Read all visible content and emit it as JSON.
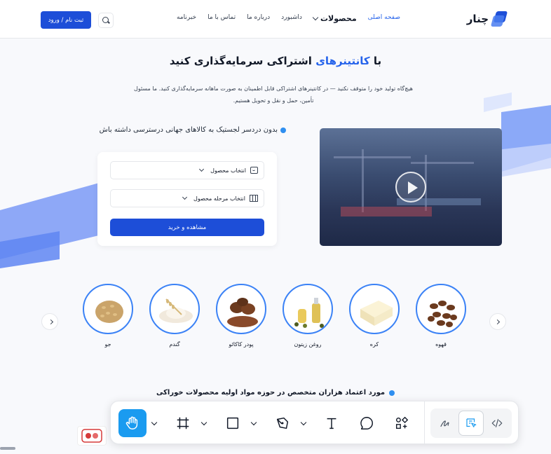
{
  "header": {
    "brand": "چنار",
    "nav": [
      {
        "label": "صفحه اصلی",
        "active": true
      },
      {
        "label": "محصولات",
        "dropdown": true
      },
      {
        "label": "داشبورد"
      },
      {
        "label": "درباره ما"
      },
      {
        "label": "تماس با ما"
      },
      {
        "label": "خبرنامه"
      }
    ],
    "signup_label": "ثبت نام / ورود"
  },
  "hero": {
    "title_pre": "با ",
    "title_highlight": "کانتینرهای",
    "title_post": " اشتراکی سرمایه‌گذاری کنید",
    "description": "هیچ‌گاه تولید خود را متوقف نکنید — در کانتینرهای اشتراکی قابل اطمینان به صورت ماهانه سرمایه‌گذاری کنید. ما مسئول تأمین، حمل و نقل و تحویل هستیم.",
    "bullet": "بدون دردسر لجستیک به کالاهای جهانی درسترسی داشته باش"
  },
  "form": {
    "product_select": "انتخاب محصول",
    "stage_select": "انتخاب مرحله محصول",
    "buy_button": "مشاهده و خرید"
  },
  "products": [
    {
      "label": "قهوه"
    },
    {
      "label": "کره"
    },
    {
      "label": "روغن زیتون"
    },
    {
      "label": "پودر کاکائو"
    },
    {
      "label": "گندم"
    },
    {
      "label": "جو"
    }
  ],
  "trust_line": "مورد اعتماد هزاران متخصص در حوزه مواد اولیه محصولات خوراکی",
  "toolbar": {
    "tools": [
      "hand-icon",
      "frame-icon",
      "rectangle-icon",
      "pen-icon",
      "text-icon",
      "comment-icon",
      "components-icon"
    ],
    "modes": [
      "draw-icon",
      "inspect-icon",
      "code-icon"
    ]
  },
  "colors": {
    "accent": "#1d4ed8",
    "highlight": "#2563eb",
    "tool_active": "#1a9bf0"
  }
}
